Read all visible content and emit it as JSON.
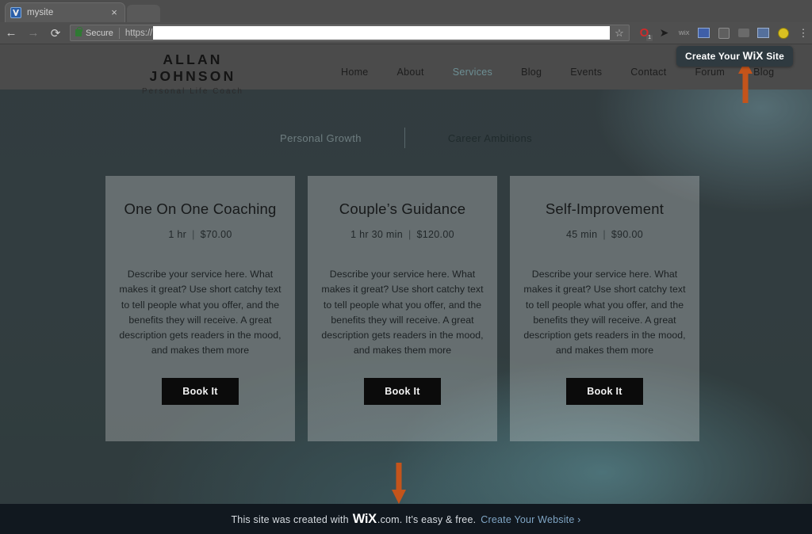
{
  "browser": {
    "tab": {
      "title": "mysite",
      "favicon": "wix-favicon",
      "close": "×"
    },
    "nav": {
      "back": "←",
      "forward": "→",
      "reload": "⟳"
    },
    "omnibox": {
      "secure_label": "Secure",
      "scheme": "https://",
      "url_value": "",
      "lock_icon": "lock-icon",
      "star_icon": "☆"
    },
    "extensions": [
      {
        "name": "opera-extension-icon",
        "glyph": "O"
      },
      {
        "name": "cursor-extension-icon",
        "glyph": "➤"
      },
      {
        "name": "wix-extension-icon",
        "glyph": "WiX"
      },
      {
        "name": "analytics-extension-icon",
        "glyph": ""
      },
      {
        "name": "badge-extension-icon",
        "glyph": ""
      },
      {
        "name": "ghost-extension-icon",
        "glyph": ""
      },
      {
        "name": "blue-extension-icon",
        "glyph": ""
      },
      {
        "name": "yellow-extension-icon",
        "glyph": ""
      }
    ],
    "menu": "⋮"
  },
  "site": {
    "logo": {
      "name": "ALLAN JOHNSON",
      "tagline": "Personal Life Coach"
    },
    "nav_items": [
      {
        "label": "Home",
        "active": false
      },
      {
        "label": "About",
        "active": false
      },
      {
        "label": "Services",
        "active": true
      },
      {
        "label": "Blog",
        "active": false
      },
      {
        "label": "Events",
        "active": false
      },
      {
        "label": "Contact",
        "active": false
      },
      {
        "label": "Forum",
        "active": false
      },
      {
        "label": "Blog",
        "active": false
      }
    ]
  },
  "tooltip": {
    "prefix": "Create Your",
    "brand": "WiX",
    "suffix": "Site"
  },
  "categories": {
    "tabs": [
      {
        "label": "Personal Growth",
        "active": false
      },
      {
        "label": "Career Ambitions",
        "active": true
      }
    ]
  },
  "services": [
    {
      "title": "One On One Coaching",
      "duration": "1 hr",
      "separator": "|",
      "price": "$70.00",
      "description": "Describe your service here. What makes it great? Use short catchy text to tell people what you offer, and the benefits they will receive. A great description gets readers in the mood, and makes them more",
      "button": "Book It"
    },
    {
      "title": "Couple’s Guidance",
      "duration": "1 hr 30 min",
      "separator": "|",
      "price": "$120.00",
      "description": "Describe your service here. What makes it great? Use short catchy text to tell people what you offer, and the benefits they will receive. A great description gets readers in the mood, and makes them more",
      "button": "Book It"
    },
    {
      "title": "Self-Improvement",
      "duration": "45 min",
      "separator": "|",
      "price": "$90.00",
      "description": "Describe your service here. What makes it great? Use short catchy text to tell people what you offer, and the benefits they will receive. A great description gets readers in the mood, and makes them more",
      "button": "Book It"
    }
  ],
  "banner": {
    "text_before": "This site was created with",
    "brand": "WiX",
    "text_after": ".com. It's easy & free.",
    "link": "Create Your Website ›"
  },
  "annotations": {
    "arrow_up": "arrow-up-annotation",
    "arrow_down": "arrow-down-annotation",
    "arrow_color": "#c4541b"
  },
  "colors": {
    "header_bar": "#4b4b4b",
    "accent_nav_active": "#6d8f94",
    "button": "#0b0b0b",
    "banner_bg": "#11181f",
    "banner_link": "#7fa5c4"
  }
}
